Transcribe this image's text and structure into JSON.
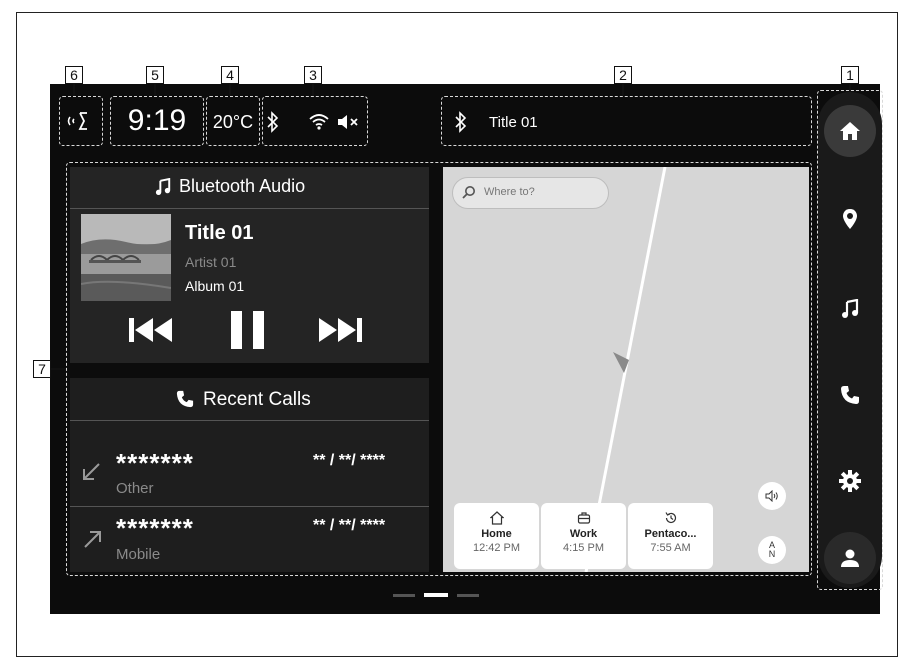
{
  "callouts": [
    "1",
    "2",
    "3",
    "4",
    "5",
    "6",
    "7"
  ],
  "status_bar": {
    "time": "9:19",
    "temperature": "20°C",
    "now_playing_title": "Title 01"
  },
  "media": {
    "header": "Bluetooth Audio",
    "title": "Title 01",
    "artist": "Artist 01",
    "album": "Album 01"
  },
  "calls": {
    "header": "Recent Calls",
    "items": [
      {
        "number": "*******",
        "date": "** / **/ ****",
        "type": "Other",
        "direction": "incoming"
      },
      {
        "number": "*******",
        "date": "** / **/ ****",
        "type": "Mobile",
        "direction": "outgoing"
      }
    ]
  },
  "map": {
    "search_placeholder": "Where to?",
    "destinations": [
      {
        "name": "Home",
        "time": "12:42 PM",
        "icon": "home-icon"
      },
      {
        "name": "Work",
        "time": "4:15 PM",
        "icon": "briefcase-icon"
      },
      {
        "name": "Pentaco...",
        "time": "7:55 AM",
        "icon": "history-icon"
      }
    ],
    "compass_label": "A\nN"
  },
  "sidebar": {
    "items": [
      "home-icon",
      "location-pin-icon",
      "music-icon",
      "phone-icon",
      "gear-icon",
      "profile-icon"
    ]
  },
  "colors": {
    "screen_bg": "#0c0c0c",
    "panel_bg": "#242424",
    "map_bg": "#d6d6d6",
    "dashed_outline": "#d9d9d9"
  }
}
